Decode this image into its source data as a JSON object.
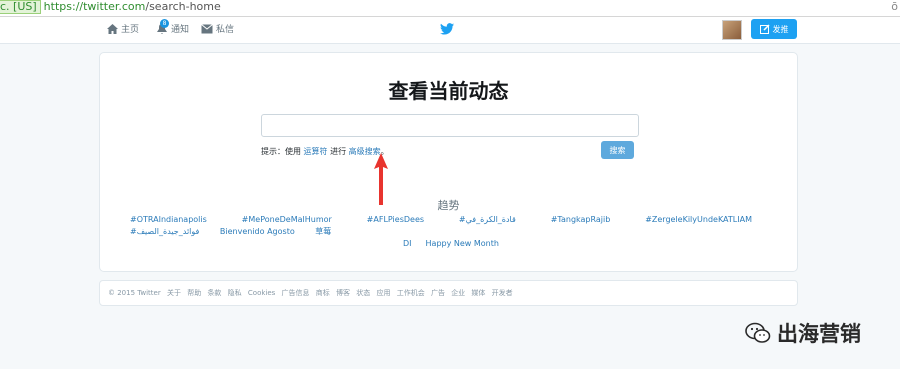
{
  "browser": {
    "secure_label": "c. [US]",
    "url_host": "https://twitter.com",
    "url_path": "/search-home",
    "right_glyph": "ō"
  },
  "nav": {
    "home": "主页",
    "notifications": "通知",
    "notifications_count": "8",
    "messages": "私信",
    "compose": "发推"
  },
  "main": {
    "heading": "查看当前动态",
    "search_placeholder": "",
    "tip_prefix": "提示：使用",
    "tip_link1": "运算符",
    "tip_mid": "进行",
    "tip_link2": "高级搜索",
    "tip_suffix": "。",
    "search_button": "搜索",
    "trends_title": "趋势",
    "trends": [
      "#OTRAIndianapolis",
      "#MePoneDeMalHumor",
      "#AFLPiesDees",
      "#قادة_الكرة_في",
      "#TangkapRajib",
      "#ZergeleKilyUndeKATLIAM",
      "#فوائد_جيدة_الصيف",
      "Bienvenido Agosto",
      "草莓",
      "DI",
      "Happy New Month"
    ]
  },
  "footer": {
    "links": [
      "© 2015 Twitter",
      "关于",
      "帮助",
      "条款",
      "隐私",
      "Cookies",
      "广告信息",
      "商标",
      "博客",
      "状态",
      "应用",
      "工作机会",
      "广告",
      "企业",
      "媒体",
      "开发者"
    ]
  },
  "watermark": {
    "text": "出海营销"
  },
  "colors": {
    "accent": "#1da1f2",
    "link": "#2b7bb9",
    "arrow": "#e8342e"
  }
}
